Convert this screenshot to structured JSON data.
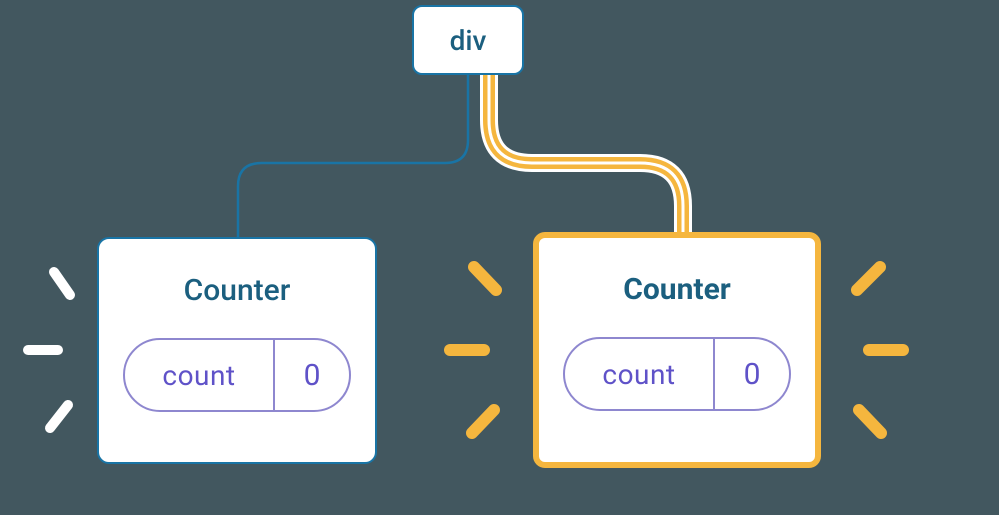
{
  "root": {
    "label": "div"
  },
  "left": {
    "title": "Counter",
    "badge": {
      "label": "count",
      "value": "0"
    }
  },
  "right": {
    "title": "Counter",
    "badge": {
      "label": "count",
      "value": "0"
    }
  },
  "colors": {
    "bg": "#42575f",
    "blue": "#1974a5",
    "orange": "#f5b63e",
    "purple": "#5f52c8"
  }
}
